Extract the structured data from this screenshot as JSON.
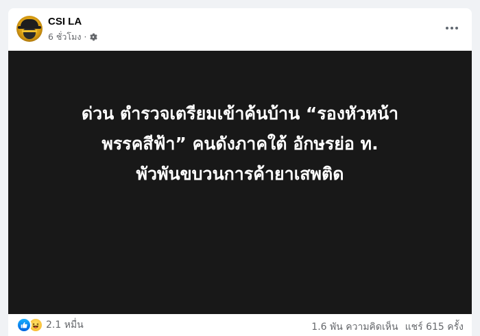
{
  "post": {
    "author": "CSI LA",
    "time": "6 ชั่วโมง",
    "separator": "·",
    "privacy_icon": "gear-icon",
    "more_icon": "more-horizontal-icon",
    "image_text_lines": [
      "ด่วน ตำรวจเตรียมเข้าค้นบ้าน “รองหัวหน้า",
      "พรรคสีฟ้า” คนดังภาคใต้ อักษรย่อ ท.",
      "พัวพันขบวนการค้ายาเสพติด"
    ]
  },
  "footer": {
    "reaction_icons": [
      "like-icon",
      "haha-icon"
    ],
    "reaction_count": "2.1 หมื่น",
    "comments": "1.6 พัน ความคิดเห็น",
    "shares": "แชร์ 615 ครั้ง"
  },
  "colors": {
    "page_bg": "#f0f2f5",
    "card_bg": "#ffffff",
    "image_bg": "#181818",
    "secondary_text": "#65676b",
    "like_blue": "#0866ff"
  }
}
